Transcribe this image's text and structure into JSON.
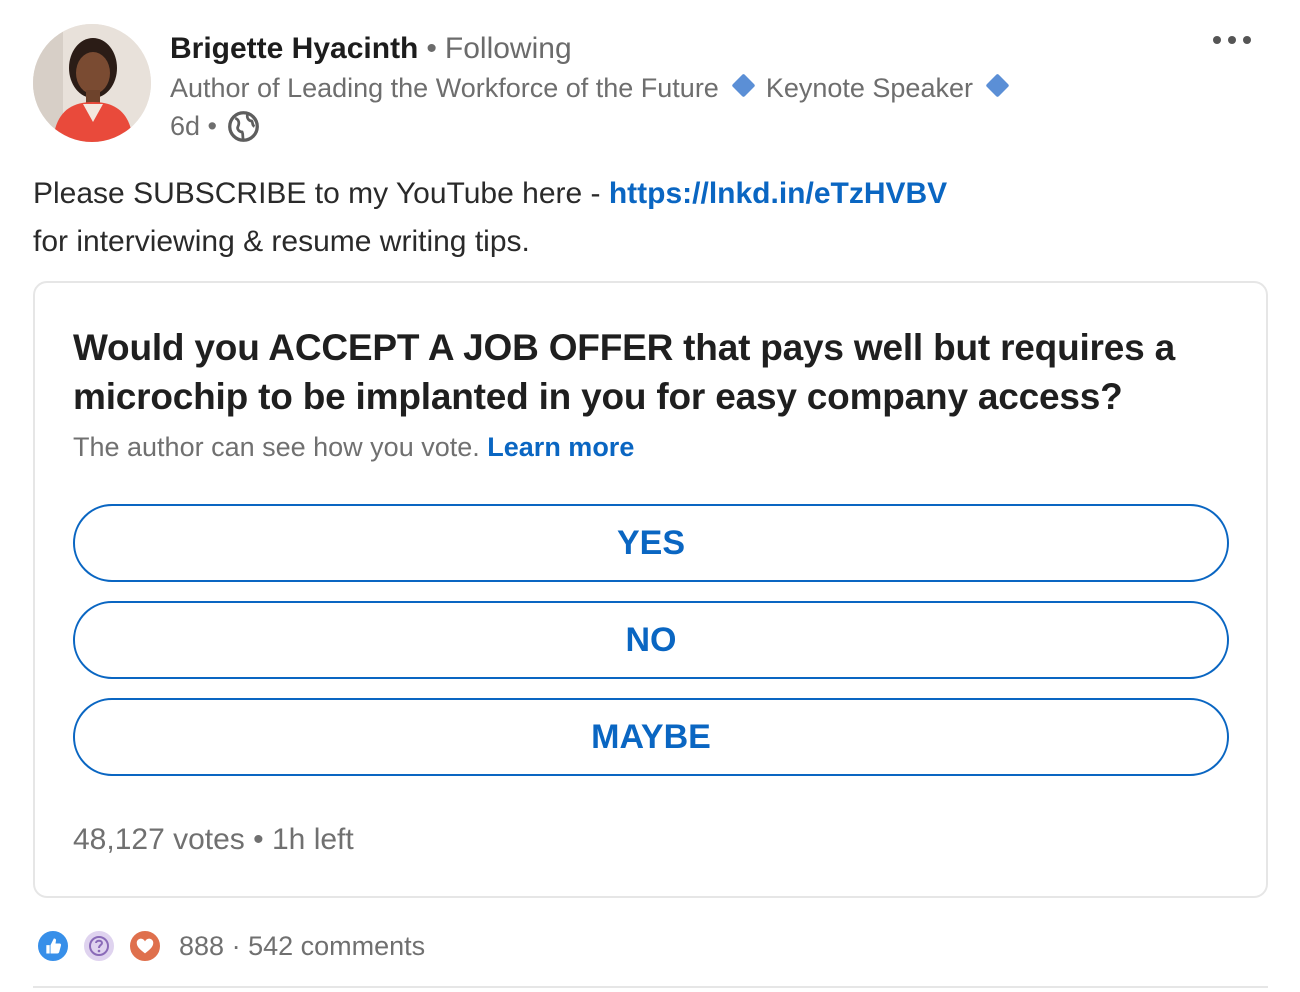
{
  "post": {
    "author_name": "Brigette Hyacinth",
    "separator": "•",
    "follow_status": "Following",
    "headline_part1": "Author of Leading the Workforce of the Future",
    "headline_part2": "Keynote Speaker",
    "time_ago": "6d •",
    "visibility_icon": "globe-icon",
    "more_icon": "ellipsis-icon",
    "text_before_link": "Please SUBSCRIBE to my YouTube here - ",
    "link": "https://lnkd.in/eTzHVBV",
    "text_after_link": "for interviewing & resume writing tips."
  },
  "poll": {
    "question": "Would you ACCEPT A JOB OFFER that pays well but requires a microchip to be implanted in you for easy company access?",
    "visibility_note": "The author can see how you vote.",
    "learn_more": "Learn more",
    "options": [
      "YES",
      "NO",
      "MAYBE"
    ],
    "votes": "48,127 votes",
    "time_left": "1h left"
  },
  "social": {
    "reaction_icons": [
      "like-icon",
      "curious-icon",
      "love-icon"
    ],
    "reactions_count": "888",
    "comments": "542 comments"
  },
  "colors": {
    "accent": "#0a66c2",
    "muted_text": "#707070",
    "border": "#e6e6e6"
  }
}
